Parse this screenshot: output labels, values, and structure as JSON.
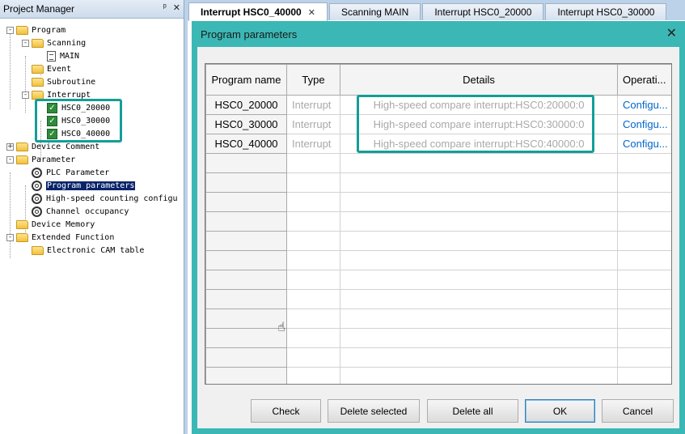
{
  "project_manager": {
    "title": "Project Manager",
    "pin_icon": "pin-icon",
    "close_icon": "close-icon",
    "tree": [
      {
        "label": "Program",
        "level": 0,
        "expander": "-",
        "icon": "folder-icon"
      },
      {
        "label": "Scanning",
        "level": 1,
        "expander": "-",
        "icon": "folder-icon"
      },
      {
        "label": "MAIN",
        "level": 2,
        "icon": "document-icon"
      },
      {
        "label": "Event",
        "level": 1,
        "icon": "folder-icon"
      },
      {
        "label": "Subroutine",
        "level": 1,
        "icon": "folder-icon"
      },
      {
        "label": "Interrupt",
        "level": 1,
        "expander": "-",
        "icon": "folder-icon"
      },
      {
        "label": "HSC0_20000",
        "level": 2,
        "icon": "check-icon"
      },
      {
        "label": "HSC0_30000",
        "level": 2,
        "icon": "check-icon"
      },
      {
        "label": "HSC0_40000",
        "level": 2,
        "icon": "check-icon"
      },
      {
        "label": "Device Comment",
        "level": 0,
        "expander": "+",
        "icon": "folder-icon"
      },
      {
        "label": "Parameter",
        "level": 0,
        "expander": "-",
        "icon": "folder-icon"
      },
      {
        "label": "PLC Parameter",
        "level": 1,
        "icon": "gear-icon"
      },
      {
        "label": "Program parameters",
        "level": 1,
        "icon": "gear-icon",
        "selected": true
      },
      {
        "label": "High-speed counting configu",
        "level": 1,
        "icon": "gear-icon"
      },
      {
        "label": "Channel occupancy",
        "level": 1,
        "icon": "gear-icon"
      },
      {
        "label": "Device Memory",
        "level": 0,
        "icon": "folder-icon"
      },
      {
        "label": "Extended Function",
        "level": 0,
        "expander": "-",
        "icon": "folder-icon"
      },
      {
        "label": "Electronic CAM table",
        "level": 1,
        "icon": "folder-icon"
      }
    ]
  },
  "tabs": [
    {
      "label": "Interrupt HSC0_40000",
      "active": true,
      "closable": true
    },
    {
      "label": "Scanning MAIN"
    },
    {
      "label": "Interrupt HSC0_20000"
    },
    {
      "label": "Interrupt HSC0_30000"
    }
  ],
  "dialog": {
    "title": "Program parameters",
    "close_glyph": "✕",
    "columns": [
      "Program name",
      "Type",
      "Details",
      "Operati..."
    ],
    "rows": [
      {
        "name": "HSC0_20000",
        "type": "Interrupt",
        "details": "High-speed compare interrupt:HSC0:20000:0",
        "operation": "Configu..."
      },
      {
        "name": "HSC0_30000",
        "type": "Interrupt",
        "details": "High-speed compare interrupt:HSC0:30000:0",
        "operation": "Configu..."
      },
      {
        "name": "HSC0_40000",
        "type": "Interrupt",
        "details": "High-speed compare interrupt:HSC0:40000:0",
        "operation": "Configu..."
      }
    ],
    "empty_rows": 12,
    "buttons": {
      "check": "Check",
      "delete_selected": "Delete selected",
      "delete_all": "Delete all",
      "ok": "OK",
      "cancel": "Cancel"
    }
  },
  "colors": {
    "dialog_frame": "#3bb8b6",
    "highlight": "#139e97",
    "link": "#0066cc",
    "tree_selection": "#0a246a"
  }
}
